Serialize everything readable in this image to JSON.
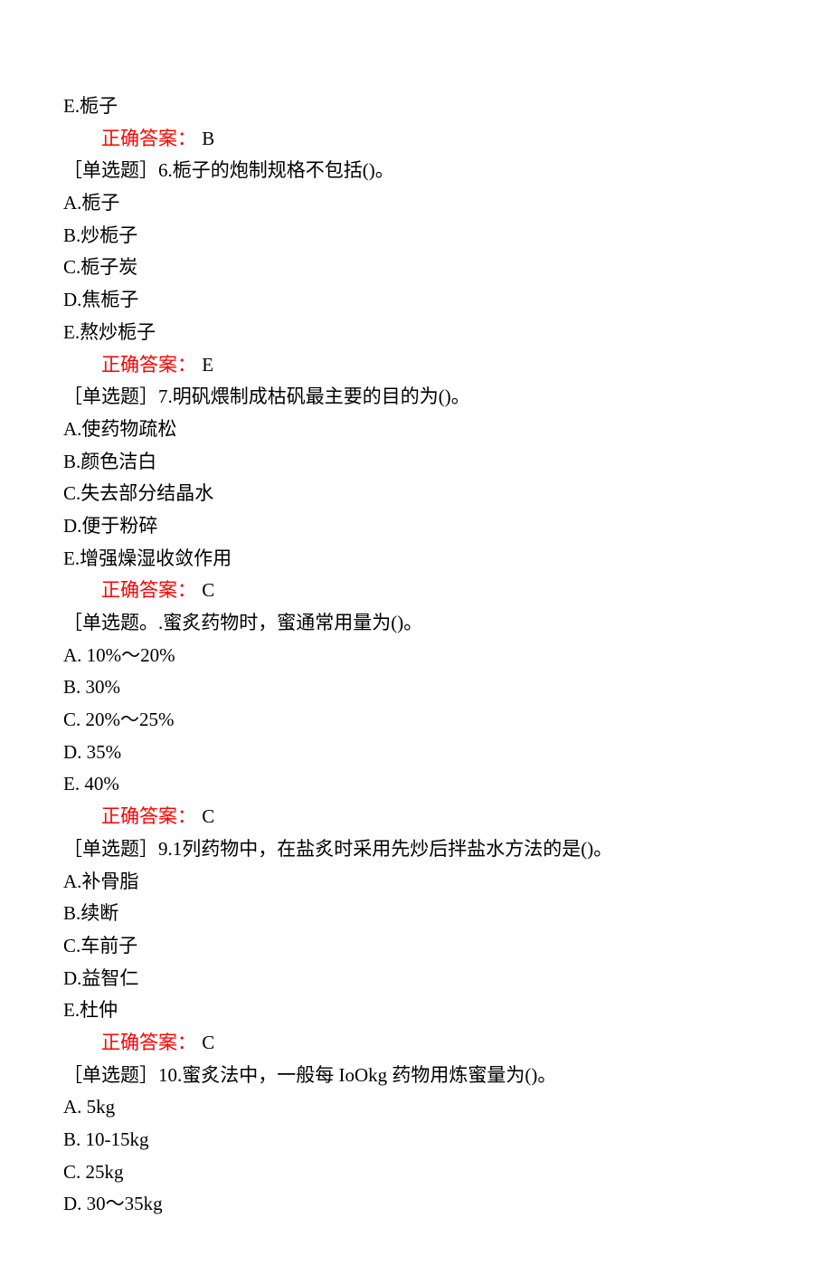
{
  "partial_end": {
    "option_e": "E.栀子",
    "answer_label": "正确答案：",
    "answer_value": "B"
  },
  "q6": {
    "prompt": "［单选题］6.栀子的炮制规格不包括()。",
    "a": "A.栀子",
    "b": "B.炒栀子",
    "c": "C.栀子炭",
    "d": "D.焦栀子",
    "e": "E.熬炒栀子",
    "answer_label": "正确答案：",
    "answer_value": "E"
  },
  "q7": {
    "prompt": "［单选题］7.明矾煨制成枯矾最主要的目的为()。",
    "a": "A.使药物疏松",
    "b": "B.颜色洁白",
    "c": "C.失去部分结晶水",
    "d": "D.便于粉碎",
    "e": "E.增强燥湿收敛作用",
    "answer_label": "正确答案：",
    "answer_value": "C"
  },
  "q8": {
    "prompt": "［单选题。.蜜炙药物时，蜜通常用量为()。",
    "a": "A. 10%～20%",
    "b": "B. 30%",
    "c": "C. 20%～25%",
    "d": "D. 35%",
    "e": "E. 40%",
    "answer_label": "正确答案：",
    "answer_value": "C"
  },
  "q9": {
    "prompt": "［单选题］9.1列药物中，在盐炙时采用先炒后拌盐水方法的是()。",
    "a": "A.补骨脂",
    "b": "B.续断",
    "c": "C.车前子",
    "d": "D.益智仁",
    "e": "E.杜仲",
    "answer_label": "正确答案：",
    "answer_value": "C"
  },
  "q10": {
    "prompt": "［单选题］10.蜜炙法中，一般每 IoOkg 药物用炼蜜量为()。",
    "a": "A. 5kg",
    "b": "B. 10-15kg",
    "c": "C. 25kg",
    "d": "D. 30～35kg"
  }
}
